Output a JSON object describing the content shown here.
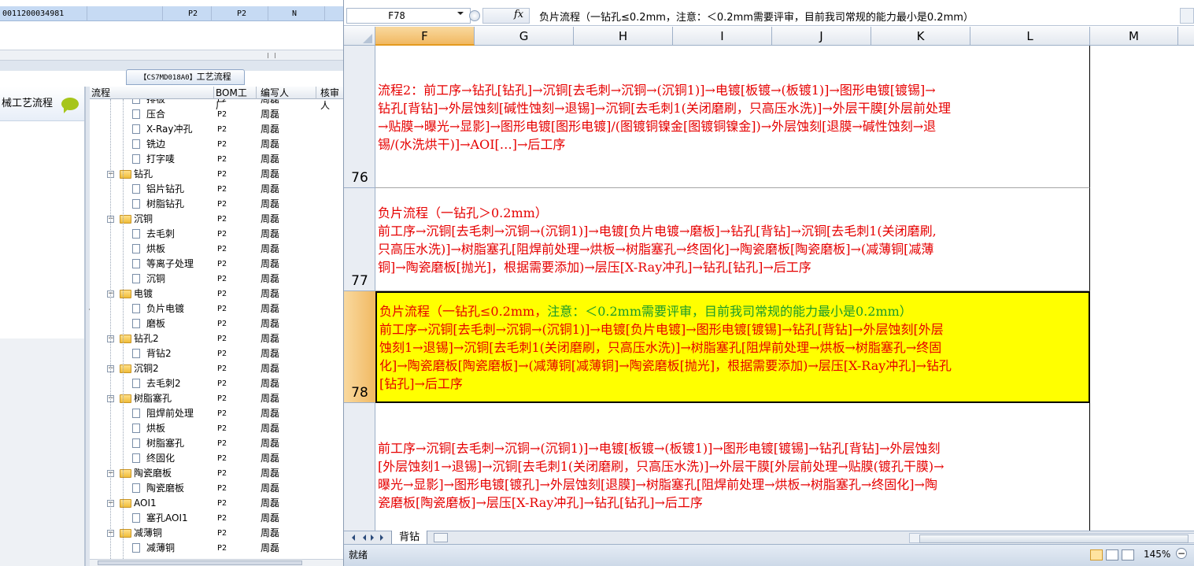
{
  "left": {
    "top_row": {
      "id": "0011200034981",
      "c1": "P2",
      "c2": "P2",
      "c3": "N"
    },
    "process_tab": {
      "code": "【CS7MD018A0】",
      "label": "工艺流程"
    },
    "side_item": "械工艺流程",
    "tree": {
      "headers": {
        "flow": "流程",
        "bom": "BOM工厂",
        "writer": "编写人",
        "reviewer": "核审人"
      },
      "rows": [
        {
          "name": "排板",
          "level": 2,
          "type": "file",
          "bom": "P2",
          "writer": "周磊"
        },
        {
          "name": "压合",
          "level": 2,
          "type": "file",
          "bom": "P2",
          "writer": "周磊"
        },
        {
          "name": "X-Ray冲孔",
          "level": 2,
          "type": "file",
          "bom": "P2",
          "writer": "周磊"
        },
        {
          "name": "铣边",
          "level": 2,
          "type": "file",
          "bom": "P2",
          "writer": "周磊"
        },
        {
          "name": "打字唛",
          "level": 2,
          "type": "file",
          "bom": "P2",
          "writer": "周磊"
        },
        {
          "name": "钻孔",
          "level": 1,
          "type": "folder",
          "bom": "P2",
          "writer": "周磊"
        },
        {
          "name": "铝片钻孔",
          "level": 2,
          "type": "file",
          "bom": "P2",
          "writer": "周磊"
        },
        {
          "name": "树脂钻孔",
          "level": 2,
          "type": "file",
          "bom": "P2",
          "writer": "周磊"
        },
        {
          "name": "沉铜",
          "level": 1,
          "type": "folder",
          "bom": "P2",
          "writer": "周磊"
        },
        {
          "name": "去毛刺",
          "level": 2,
          "type": "file",
          "bom": "P2",
          "writer": "周磊"
        },
        {
          "name": "烘板",
          "level": 2,
          "type": "file",
          "bom": "P2",
          "writer": "周磊"
        },
        {
          "name": "等离子处理",
          "level": 2,
          "type": "file",
          "bom": "P2",
          "writer": "周磊"
        },
        {
          "name": "沉铜",
          "level": 2,
          "type": "file",
          "bom": "P2",
          "writer": "周磊"
        },
        {
          "name": "电镀",
          "level": 1,
          "type": "folder",
          "bom": "P2",
          "writer": "周磊"
        },
        {
          "name": "负片电镀",
          "level": 2,
          "type": "file",
          "bom": "P2",
          "writer": "周磊"
        },
        {
          "name": "磨板",
          "level": 2,
          "type": "file",
          "bom": "P2",
          "writer": "周磊"
        },
        {
          "name": "钻孔2",
          "level": 1,
          "type": "folder",
          "bom": "P2",
          "writer": "周磊"
        },
        {
          "name": "背钻2",
          "level": 2,
          "type": "file",
          "bom": "P2",
          "writer": "周磊"
        },
        {
          "name": "沉铜2",
          "level": 1,
          "type": "folder",
          "bom": "P2",
          "writer": "周磊"
        },
        {
          "name": "去毛刺2",
          "level": 2,
          "type": "file",
          "bom": "P2",
          "writer": "周磊"
        },
        {
          "name": "树脂塞孔",
          "level": 1,
          "type": "folder",
          "bom": "P2",
          "writer": "周磊"
        },
        {
          "name": "阻焊前处理",
          "level": 2,
          "type": "file",
          "bom": "P2",
          "writer": "周磊"
        },
        {
          "name": "烘板",
          "level": 2,
          "type": "file",
          "bom": "P2",
          "writer": "周磊"
        },
        {
          "name": "树脂塞孔",
          "level": 2,
          "type": "file",
          "bom": "P2",
          "writer": "周磊"
        },
        {
          "name": "终固化",
          "level": 2,
          "type": "file",
          "bom": "P2",
          "writer": "周磊"
        },
        {
          "name": "陶瓷磨板",
          "level": 1,
          "type": "folder",
          "bom": "P2",
          "writer": "周磊"
        },
        {
          "name": "陶瓷磨板",
          "level": 2,
          "type": "file",
          "bom": "P2",
          "writer": "周磊"
        },
        {
          "name": "AOI1",
          "level": 1,
          "type": "folder",
          "bom": "P2",
          "writer": "周磊"
        },
        {
          "name": "塞孔AOI1",
          "level": 2,
          "type": "file",
          "bom": "P2",
          "writer": "周磊"
        },
        {
          "name": "减薄铜",
          "level": 1,
          "type": "folder",
          "bom": "P2",
          "writer": "周磊"
        },
        {
          "name": "减薄铜",
          "level": 2,
          "type": "file",
          "bom": "P2",
          "writer": "周磊"
        }
      ]
    }
  },
  "excel": {
    "name_box": "F78",
    "fx_label": "fx",
    "formula": "负片流程（一钻孔≤0.2mm，注意：＜0.2mm需要评审，目前我司常规的能力最小是0.2mm）",
    "columns": [
      "F",
      "G",
      "H",
      "I",
      "J",
      "K",
      "L",
      "M"
    ],
    "rows": [
      {
        "num": "76",
        "lines": [
          "流程2：前工序→钻孔[钻孔]→沉铜[去毛刺→沉铜→(沉铜1)]→电镀[板镀→(板镀1)]→图形电镀[镀锡]→",
          "钻孔[背钻]→外层蚀刻[碱性蚀刻→退锡]→沉铜[去毛刺1(关闭磨刷，只高压水洗)]→外层干膜[外层前处理",
          "→贴膜→曝光→显影]→图形电镀[图形电镀]/(图镀铜镍金[图镀铜镍金])→外层蚀刻[退膜→碱性蚀刻→退",
          "锡/(水洗烘干)]→AOI[…]→后工序"
        ]
      },
      {
        "num": "77",
        "lines": [
          "负片流程（一钻孔＞0.2mm）",
          "前工序→沉铜[去毛刺→沉铜→(沉铜1)]→电镀[负片电镀→磨板]→钻孔[背钻]→沉铜[去毛刺1(关闭磨刷,",
          "只高压水洗)]→树脂塞孔[阻焊前处理→烘板→树脂塞孔→终固化]→陶瓷磨板[陶瓷磨板]→(减薄铜[减薄",
          "铜]→陶瓷磨板[抛光]，根据需要添加)→层压[X-Ray冲孔]→钻孔[钻孔]→后工序"
        ]
      },
      {
        "num": "78",
        "first_red": "负片流程（一钻孔≤0.2mm，",
        "first_green": "注意：＜0.2mm需要评审，目前我司常规的能力最小是0.2mm）",
        "lines": [
          "前工序→沉铜[去毛刺→沉铜→(沉铜1)]→电镀[负片电镀]→图形电镀[镀锡]→钻孔[背钻]→外层蚀刻[外层",
          "蚀刻1→退锡]→沉铜[去毛刺1(关闭磨刷，只高压水洗)]→树脂塞孔[阻焊前处理→烘板→树脂塞孔→终固",
          "化]→陶瓷磨板[陶瓷磨板]→(减薄铜[减薄铜]→陶瓷磨板[抛光]，根据需要添加)→层压[X-Ray冲孔]→钻孔",
          "[钻孔]→后工序"
        ]
      },
      {
        "num": "79",
        "lines": [
          "前工序→沉铜[去毛刺→沉铜→(沉铜1)]→电镀[板镀→(板镀1)]→图形电镀[镀锡]→钻孔[背钻]→外层蚀刻",
          "[外层蚀刻1→退锡]→沉铜[去毛刺1(关闭磨刷，只高压水洗)]→外层干膜[外层前处理→贴膜(镀孔干膜)→",
          "曝光→显影]→图形电镀[镀孔]→外层蚀刻[退膜]→树脂塞孔[阻焊前处理→烘板→树脂塞孔→终固化]→陶",
          "瓷磨板[陶瓷磨板]→层压[X-Ray冲孔]→钻孔[钻孔]→后工序"
        ]
      }
    ],
    "sheet_tab": "背钻",
    "status": "就绪",
    "zoom": "145%",
    "colors": {
      "text_red": "#e60000",
      "text_green": "#1a9a2a",
      "highlight": "#ffff00"
    }
  }
}
